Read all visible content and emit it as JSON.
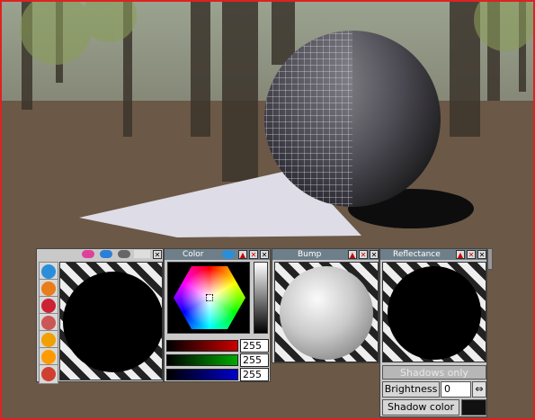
{
  "viewport": {
    "border_color": "#d22222"
  },
  "panels": {
    "materials": {
      "title": "",
      "tools": [
        {
          "icon": "globe-icon"
        },
        {
          "icon": "funnel-icon"
        },
        {
          "icon": "brush-icon"
        },
        {
          "icon": "pipette-icon"
        },
        {
          "icon": "cylinder-icon"
        },
        {
          "icon": "sphere-icon"
        },
        {
          "icon": "ball-icon"
        }
      ]
    },
    "color": {
      "title": "Color",
      "rgb": {
        "red": "255",
        "green": "255",
        "blue": "255"
      },
      "colors": {
        "red": "#cc0000",
        "green": "#00aa00",
        "blue": "#0000cc"
      }
    },
    "bump": {
      "title": "Bump"
    },
    "reflectance": {
      "title": "Reflectance",
      "shadows_only": "Shadows only",
      "brightness_label": "Brightness",
      "brightness_value": "0",
      "shadow_color_label": "Shadow color",
      "shadow_color": "#111111"
    }
  },
  "buttons": {
    "up": "▲",
    "x": "✕",
    "close": "✕"
  }
}
